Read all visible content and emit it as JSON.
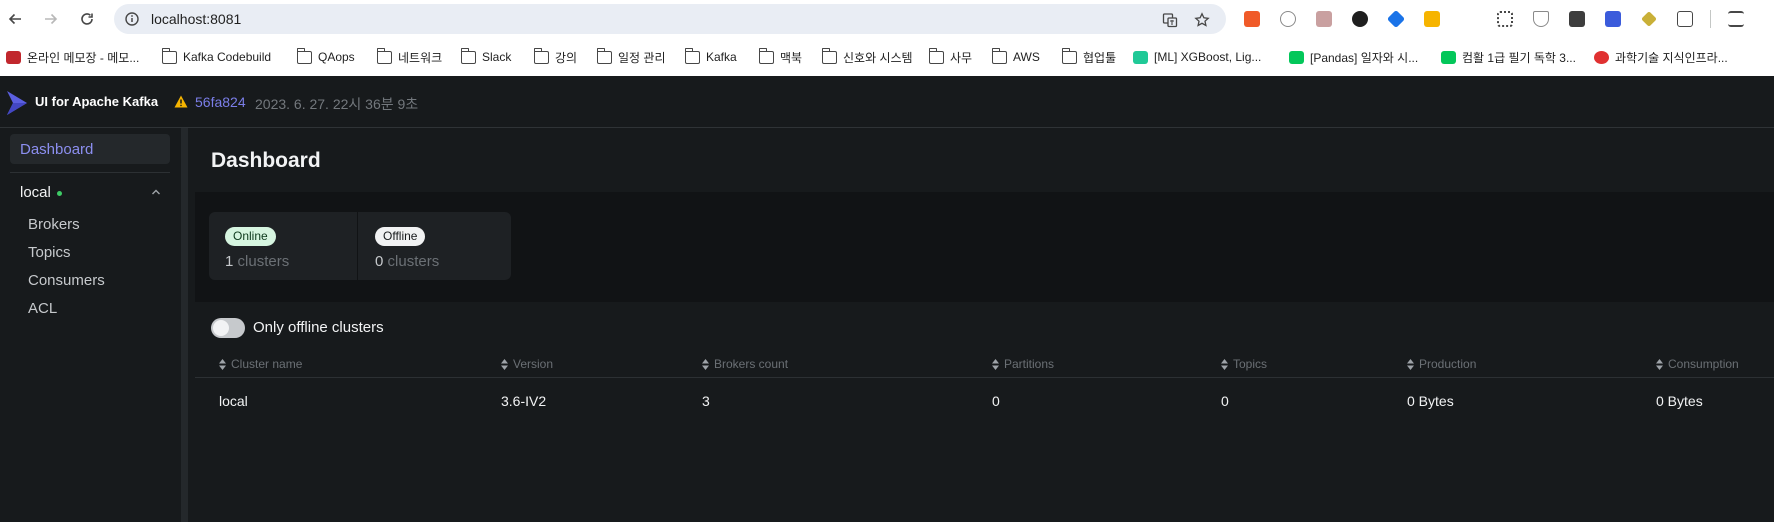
{
  "browser": {
    "url": "localhost:8081",
    "bookmarks": [
      {
        "label": "온라인 메모장 - 메모...",
        "icon": "note-icon"
      },
      {
        "label": "Kafka Codebuild",
        "icon": "folder-icon"
      },
      {
        "label": "QAops",
        "icon": "folder-icon"
      },
      {
        "label": "네트워크",
        "icon": "folder-icon"
      },
      {
        "label": "Slack",
        "icon": "folder-icon"
      },
      {
        "label": "강의",
        "icon": "folder-icon"
      },
      {
        "label": "일정 관리",
        "icon": "folder-icon"
      },
      {
        "label": "Kafka",
        "icon": "folder-icon"
      },
      {
        "label": "맥북",
        "icon": "folder-icon"
      },
      {
        "label": "신호와 시스템",
        "icon": "folder-icon"
      },
      {
        "label": "사무",
        "icon": "folder-icon"
      },
      {
        "label": "AWS",
        "icon": "folder-icon"
      },
      {
        "label": "협업툴",
        "icon": "folder-icon"
      },
      {
        "label": "[ML] XGBoost, Lig...",
        "icon": "velog-icon"
      },
      {
        "label": "[Pandas] 일자와 시...",
        "icon": "blog-icon"
      },
      {
        "label": "컴활 1급 필기 독학 3...",
        "icon": "blog-icon"
      },
      {
        "label": "과학기술 지식인프라...",
        "icon": "site-icon"
      }
    ]
  },
  "app": {
    "title": "UI for Apache Kafka",
    "commit": "56fa824",
    "build_date": "2023. 6. 27. 22시 36분 9초"
  },
  "sidebar": {
    "dashboard": "Dashboard",
    "cluster": "local",
    "items": [
      {
        "label": "Brokers"
      },
      {
        "label": "Topics"
      },
      {
        "label": "Consumers"
      },
      {
        "label": "ACL"
      }
    ]
  },
  "main": {
    "title": "Dashboard",
    "metrics": {
      "online_label": "Online",
      "online_value": "1",
      "online_unit": "clusters",
      "offline_label": "Offline",
      "offline_value": "0",
      "offline_unit": "clusters"
    },
    "toggle_label": "Only offline clusters",
    "table": {
      "columns": [
        "Cluster name",
        "Version",
        "Brokers count",
        "Partitions",
        "Topics",
        "Production",
        "Consumption"
      ],
      "rows": [
        [
          "local",
          "3.6-IV2",
          "3",
          "0",
          "0",
          "0 Bytes",
          "0 Bytes"
        ]
      ]
    }
  },
  "colors": {
    "accent": "#7b7ee8",
    "online": "#3ecb66",
    "background": "#171a1c"
  }
}
